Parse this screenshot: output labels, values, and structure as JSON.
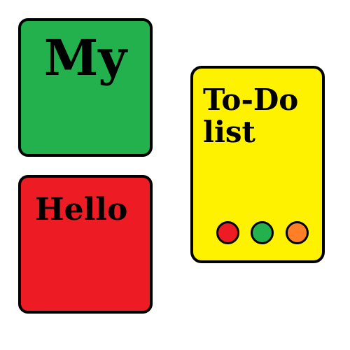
{
  "tiles": {
    "my": {
      "label": "My",
      "color": "#22b14c"
    },
    "hello": {
      "label": "Hello",
      "color": "#ed1c24"
    },
    "todo": {
      "label": "To-Do list",
      "color": "#fff200",
      "dots": [
        {
          "color": "#ed1c24"
        },
        {
          "color": "#22b14c"
        },
        {
          "color": "#ff7f27"
        }
      ]
    }
  }
}
